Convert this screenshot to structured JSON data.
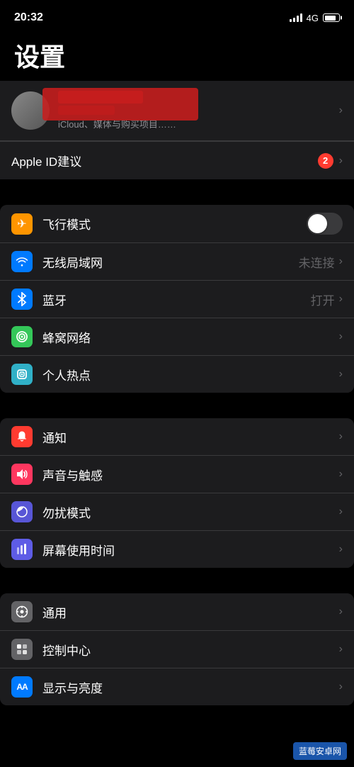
{
  "statusBar": {
    "time": "20:32",
    "networkType": "4G"
  },
  "pageTitle": "设置",
  "accountRow": {
    "icloudText": "iCloud、媒体与购买项目……"
  },
  "appleIdRow": {
    "label": "Apple ID建议",
    "badgeCount": "2"
  },
  "networkGroup": [
    {
      "id": "airplane",
      "iconBg": "icon-orange",
      "iconSymbol": "✈",
      "label": "飞行模式",
      "value": "",
      "hasToggle": true,
      "toggleOn": false,
      "hasChevron": false
    },
    {
      "id": "wifi",
      "iconBg": "icon-blue",
      "iconSymbol": "📶",
      "label": "无线局域网",
      "value": "未连接",
      "hasToggle": false,
      "hasChevron": true
    },
    {
      "id": "bluetooth",
      "iconBg": "icon-blue-dark",
      "iconSymbol": "❄",
      "label": "蓝牙",
      "value": "打开",
      "hasToggle": false,
      "hasChevron": true
    },
    {
      "id": "cellular",
      "iconBg": "icon-green",
      "iconSymbol": "((·))",
      "label": "蜂窝网络",
      "value": "",
      "hasToggle": false,
      "hasChevron": true
    },
    {
      "id": "hotspot",
      "iconBg": "icon-teal",
      "iconSymbol": "◎",
      "label": "个人热点",
      "value": "",
      "hasToggle": false,
      "hasChevron": true
    }
  ],
  "notifGroup": [
    {
      "id": "notifications",
      "iconBg": "icon-red",
      "iconSymbol": "🔔",
      "label": "通知",
      "value": "",
      "hasToggle": false,
      "hasChevron": true
    },
    {
      "id": "sounds",
      "iconBg": "icon-pink",
      "iconSymbol": "🔊",
      "label": "声音与触感",
      "value": "",
      "hasToggle": false,
      "hasChevron": true
    },
    {
      "id": "donotdisturb",
      "iconBg": "icon-purple",
      "iconSymbol": "🌙",
      "label": "勿扰模式",
      "value": "",
      "hasToggle": false,
      "hasChevron": true
    },
    {
      "id": "screentime",
      "iconBg": "icon-indigo",
      "iconSymbol": "⏱",
      "label": "屏幕使用时间",
      "value": "",
      "hasToggle": false,
      "hasChevron": true
    }
  ],
  "generalGroup": [
    {
      "id": "general",
      "iconBg": "icon-gray",
      "iconSymbol": "⚙",
      "label": "通用",
      "value": "",
      "hasToggle": false,
      "hasChevron": true
    },
    {
      "id": "controlcenter",
      "iconBg": "icon-gray",
      "iconSymbol": "⊞",
      "label": "控制中心",
      "value": "",
      "hasToggle": false,
      "hasChevron": true
    },
    {
      "id": "display",
      "iconBg": "icon-blue",
      "iconSymbol": "AA",
      "label": "显示与亮度",
      "value": "",
      "hasToggle": false,
      "hasChevron": true
    }
  ],
  "watermark": "蓝莓安卓网"
}
